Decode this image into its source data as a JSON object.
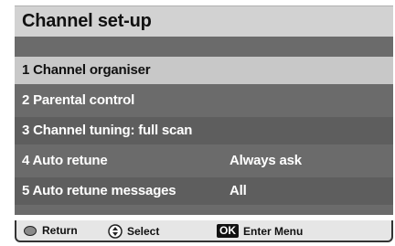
{
  "title": "Channel set-up",
  "menu": [
    {
      "label": "1  Channel organiser",
      "value": ""
    },
    {
      "label": "2  Parental control",
      "value": ""
    },
    {
      "label": "3  Channel tuning: full scan",
      "value": ""
    },
    {
      "label": "4  Auto retune",
      "value": "Always ask"
    },
    {
      "label": "5  Auto retune messages",
      "value": "All"
    }
  ],
  "footer": {
    "return_label": "Return",
    "select_label": "Select",
    "ok_label": "OK",
    "enter_label": "Enter Menu"
  },
  "icons": {
    "return": "round-button-icon",
    "select": "up-down-arrows-icon"
  }
}
